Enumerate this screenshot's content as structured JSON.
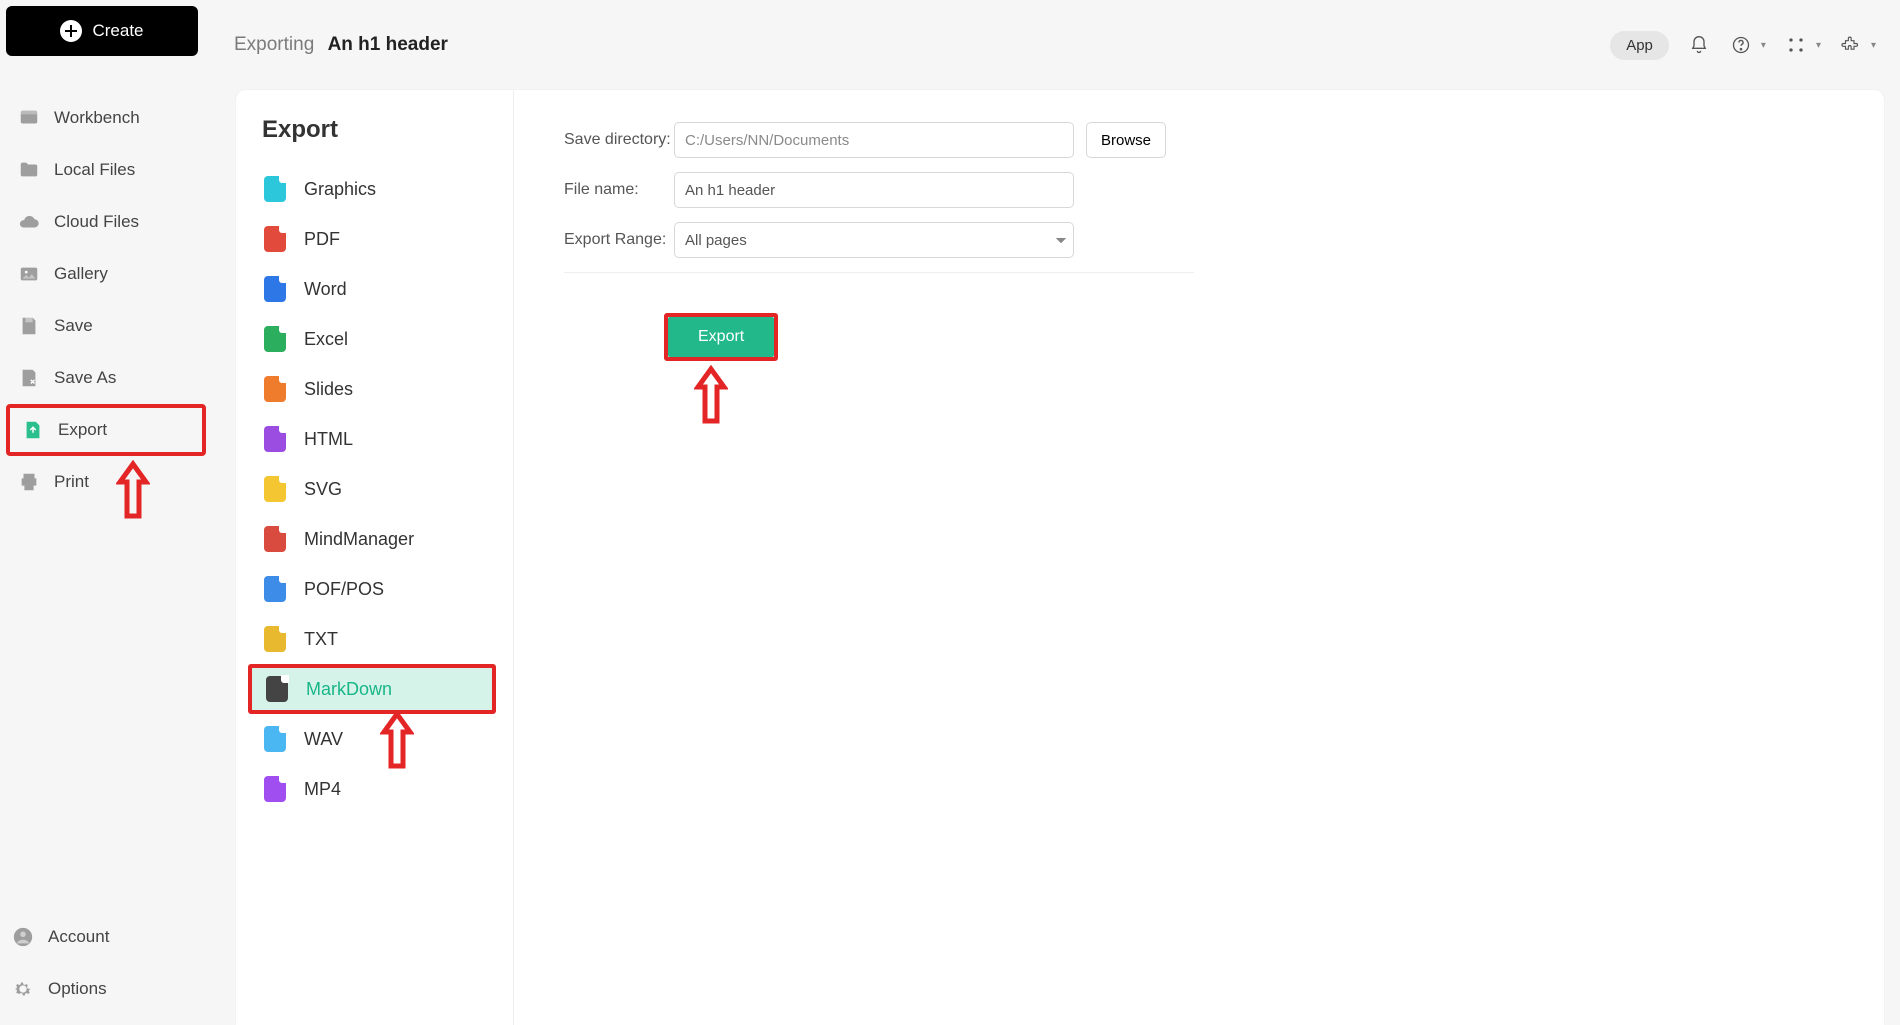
{
  "header": {
    "breadcrumb": "Exporting",
    "title": "An h1 header",
    "app_pill": "App"
  },
  "create_label": "Create",
  "sidebar": [
    {
      "id": "workbench",
      "label": "Workbench",
      "icon": "workbench-icon"
    },
    {
      "id": "localfiles",
      "label": "Local Files",
      "icon": "folder-icon"
    },
    {
      "id": "cloudfiles",
      "label": "Cloud Files",
      "icon": "cloud-icon"
    },
    {
      "id": "gallery",
      "label": "Gallery",
      "icon": "gallery-icon"
    },
    {
      "id": "save",
      "label": "Save",
      "icon": "save-icon"
    },
    {
      "id": "saveas",
      "label": "Save As",
      "icon": "saveas-icon"
    },
    {
      "id": "export",
      "label": "Export",
      "icon": "export-icon",
      "highlight": true
    },
    {
      "id": "print",
      "label": "Print",
      "icon": "print-icon"
    }
  ],
  "sidebar_bottom": [
    {
      "id": "account",
      "label": "Account",
      "icon": "account-icon"
    },
    {
      "id": "options",
      "label": "Options",
      "icon": "gear-icon"
    }
  ],
  "export_panel": {
    "heading": "Export",
    "types": [
      {
        "id": "graphics",
        "label": "Graphics",
        "color": "c-teal"
      },
      {
        "id": "pdf",
        "label": "PDF",
        "color": "c-red"
      },
      {
        "id": "word",
        "label": "Word",
        "color": "c-blue"
      },
      {
        "id": "excel",
        "label": "Excel",
        "color": "c-green"
      },
      {
        "id": "slides",
        "label": "Slides",
        "color": "c-orange"
      },
      {
        "id": "html",
        "label": "HTML",
        "color": "c-purple"
      },
      {
        "id": "svg",
        "label": "SVG",
        "color": "c-yellow"
      },
      {
        "id": "mindmanager",
        "label": "MindManager",
        "color": "c-redm"
      },
      {
        "id": "pofpos",
        "label": "POF/POS",
        "color": "c-blue2"
      },
      {
        "id": "txt",
        "label": "TXT",
        "color": "c-gold"
      },
      {
        "id": "markdown",
        "label": "MarkDown",
        "color": "c-dark",
        "selected": true
      },
      {
        "id": "wav",
        "label": "WAV",
        "color": "c-sky"
      },
      {
        "id": "mp4",
        "label": "MP4",
        "color": "c-violet"
      }
    ]
  },
  "form": {
    "dir_label": "Save directory:",
    "dir_placeholder": "C:/Users/NN/Documents",
    "browse": "Browse",
    "name_label": "File name:",
    "name_value": "An h1 header",
    "range_label": "Export Range:",
    "range_value": "All pages",
    "export_btn": "Export"
  }
}
